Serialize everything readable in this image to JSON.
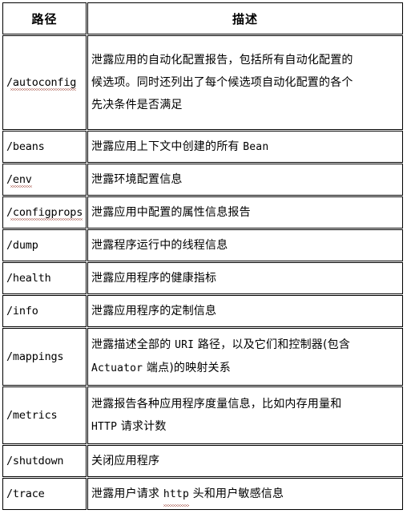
{
  "table": {
    "headers": {
      "path": "路径",
      "description": "描述"
    },
    "rows": [
      {
        "path": "/autoconfig",
        "path_has_squiggle": true,
        "lines": [
          "泄露应用的自动化配置报告，包括所有自动化配置的",
          "候选项。同时还列出了每个候选项自动化配置的各个",
          "先决条件是否满足"
        ],
        "height": "tall"
      },
      {
        "path": "/beans",
        "path_has_squiggle": false,
        "lines": [
          "泄露应用上下文中创建的所有 Bean"
        ],
        "height": "short"
      },
      {
        "path": "/env",
        "path_has_squiggle": true,
        "lines": [
          "泄露环境配置信息"
        ],
        "height": "short"
      },
      {
        "path": "/configprops",
        "path_has_squiggle": true,
        "lines": [
          "泄露应用中配置的属性信息报告"
        ],
        "height": "short"
      },
      {
        "path": "/dump",
        "path_has_squiggle": false,
        "lines": [
          "泄露程序运行中的线程信息"
        ],
        "height": "short"
      },
      {
        "path": "/health",
        "path_has_squiggle": false,
        "lines": [
          "泄露应用程序的健康指标"
        ],
        "height": "short"
      },
      {
        "path": "/info",
        "path_has_squiggle": false,
        "lines": [
          "泄露应用程序的定制信息"
        ],
        "height": "short"
      },
      {
        "path": "/mappings",
        "path_has_squiggle": false,
        "lines": [
          "泄露描述全部的 URI 路径，以及它们和控制器(包含",
          "Actuator 端点)的映射关系"
        ],
        "height": "mid"
      },
      {
        "path": "/metrics",
        "path_has_squiggle": false,
        "lines": [
          "泄露报告各种应用程序度量信息，比如内存用量和",
          "HTTP 请求计数"
        ],
        "height": "mid"
      },
      {
        "path": "/shutdown",
        "path_has_squiggle": false,
        "lines": [
          "关闭应用程序"
        ],
        "height": "short"
      },
      {
        "path": "/trace",
        "path_has_squiggle": false,
        "lines": [
          "泄露用户请求 http 头和用户敏感信息"
        ],
        "height": "short"
      }
    ]
  },
  "colors": {
    "border": "#000000",
    "text": "#000000",
    "background": "#ffffff",
    "spellcheck_squiggle": "#9b3b2e"
  }
}
